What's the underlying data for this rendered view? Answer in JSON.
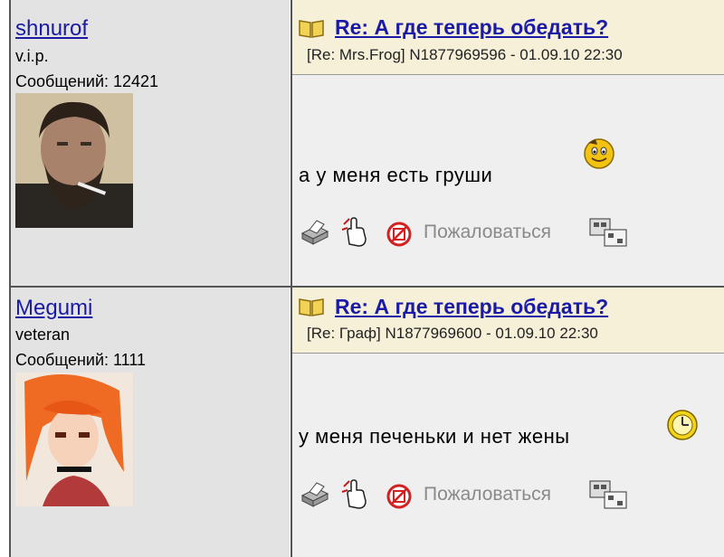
{
  "posts": [
    {
      "author": {
        "name": "shnurof",
        "rank": "v.i.p.",
        "posts_count": "Сообщений: 12421"
      },
      "title": "Re: А где теперь обедать?",
      "meta": "[Re: Mrs.Frog]  N1877969596 - 01.09.10 22:30",
      "message": "а у меня есть груши",
      "smiley": "grinning-smiley-icon",
      "actions": {
        "complain_label": "Пожаловаться"
      }
    },
    {
      "author": {
        "name": "Megumi",
        "rank": "veteran",
        "posts_count": "Сообщений: 1111"
      },
      "title": "Re: А где теперь обедать?",
      "meta": "[Re: Граф]  N1877969600 - 01.09.10 22:30",
      "message": "у меня печеньки и нет жены",
      "smiley": "clock-smiley-icon",
      "actions": {
        "complain_label": "Пожаловаться"
      }
    }
  ],
  "colors": {
    "link": "#1a1aa6",
    "author_bg": "#e3e3e3",
    "post_bg": "#efefef",
    "header_bg": "#f6f0d9",
    "border": "#555555"
  }
}
